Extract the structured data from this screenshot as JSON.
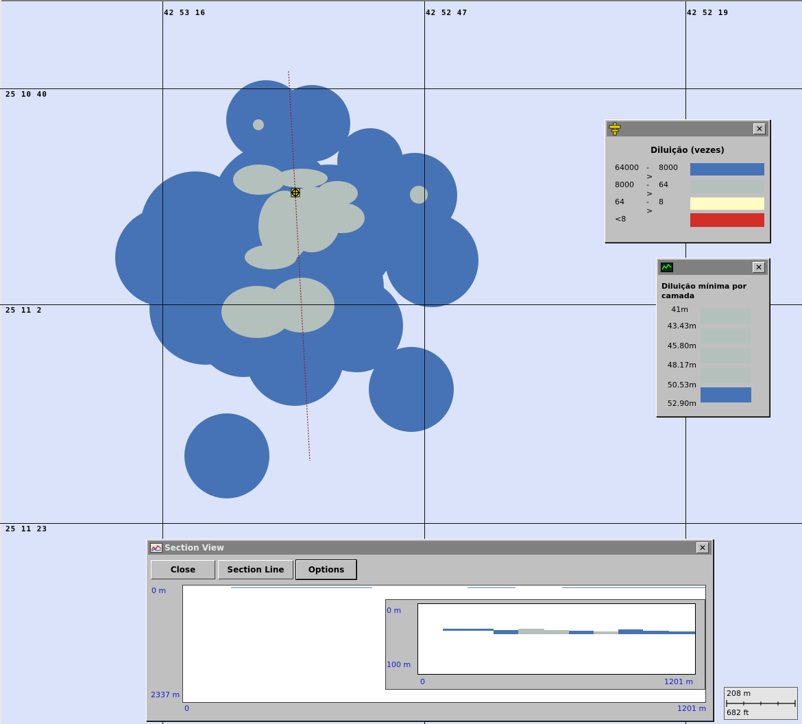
{
  "map": {
    "coords_top": [
      "42 53 16",
      "42 52 47",
      "42 52 19"
    ],
    "coords_left": [
      "25 10 40",
      "25 11 2",
      "25 11 23"
    ],
    "colors": {
      "background": "#dbe3fb",
      "high": "#4673b5",
      "mid": "#b4c0bb",
      "low": "#fffcc4",
      "lowest": "#d32e28",
      "section_line": "#8b1a2a"
    },
    "icons": {
      "marker": "crosshair-marker-icon"
    }
  },
  "legend_dilution": {
    "icon": "yellow-tool-icon",
    "close": "✕",
    "title": "Diluição (vezes)",
    "rows": [
      {
        "from": "64000",
        "arrow": "->",
        "to": "8000",
        "color": "#4673b5"
      },
      {
        "from": "8000",
        "arrow": "->",
        "to": "64",
        "color": "#b4c0bb"
      },
      {
        "from": "64",
        "arrow": "->",
        "to": "8",
        "color": "#fffcc4"
      },
      {
        "from": "<8",
        "arrow": "",
        "to": "",
        "color": "#d32e28"
      }
    ]
  },
  "legend_layers": {
    "icon": "green-monitor-icon",
    "close": "✕",
    "title": "Diluição mínima por camada",
    "labels": [
      "41m",
      "43.43m",
      "45.80m",
      "48.17m",
      "50.53m",
      "52.90m"
    ],
    "swatch_colors": [
      "#b4c0bb",
      "#b4c0bb",
      "#b4c0bb",
      "#b4c0bb",
      "#4673b5"
    ]
  },
  "section_view": {
    "icon": "section-chart-icon",
    "title": "Section View",
    "close": "✕",
    "buttons": {
      "close": "Close",
      "section_line": "Section Line",
      "options": "Options"
    },
    "main_plot": {
      "y_top": "0 m",
      "y_bottom": "2337 m",
      "x_left": "0",
      "x_right": "1201 m"
    },
    "inset_plot": {
      "y_top": "0 m",
      "y_bottom": "100 m",
      "x_left": "0",
      "x_right": "1201 m"
    }
  },
  "scale_bar": {
    "top": "208 m",
    "bottom": "682 ft"
  }
}
